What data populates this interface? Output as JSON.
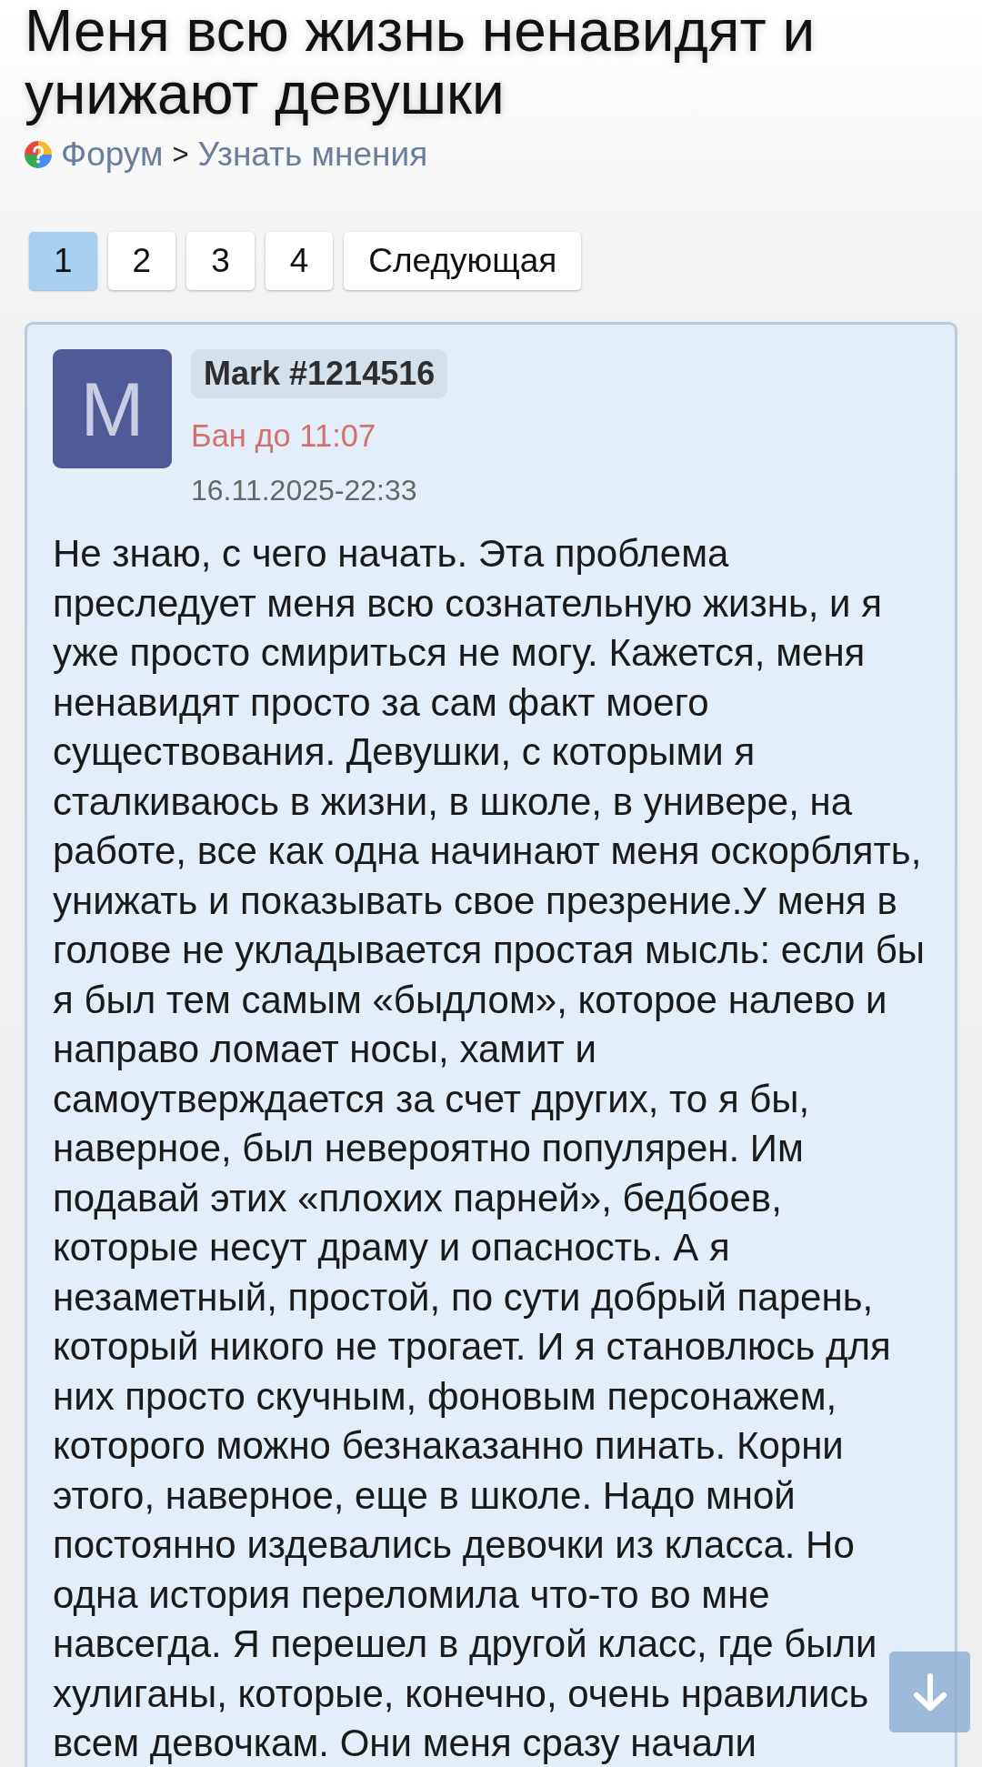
{
  "title": "Меня всю жизнь ненавидят и унижают девушки",
  "breadcrumb": {
    "items": [
      {
        "label": "Форум"
      },
      {
        "label": "Узнать мнения"
      }
    ],
    "separator": ">"
  },
  "pagination": [
    {
      "label": "1",
      "selected": true
    },
    {
      "label": "2",
      "selected": false
    },
    {
      "label": "3",
      "selected": false
    },
    {
      "label": "4",
      "selected": false
    },
    {
      "label": "Следующая",
      "selected": false
    }
  ],
  "post": {
    "avatar_letter": "M",
    "username": "Mark #1214516",
    "ban_status": "Бан до 11:07",
    "date": "16.11.2025-22:33",
    "body": "Не знаю, с чего начать. Эта проблема преследует меня всю сознательную жизнь, и я уже просто смириться не могу. Кажется, меня ненавидят просто за сам факт моего существования. Девушки, с которыми я сталкиваюсь в жизни, в школе, в универе, на работе, все как одна начинают меня оскорблять, унижать и показывать свое презрение.У меня в голове не укладывается простая мысль: если бы я был тем самым «быдлом», которое налево и направо ломает носы, хамит и самоутверждается за счет других, то я бы, наверное, был невероятно популярен. Им подавай этих «плохих парней», бедбоев, которые несут драму и опасность. А я незаметный, простой, по сути добрый парень, который никого не трогает. И я становлюсь для них просто скучным, фоновым персонажем, которого можно безнаказанно пинать. Корни этого, наверное, еще в школе. Надо мной постоянно издевались девочки из класса. Но одна история переломила что-то во мне навсегда. Я перешел в другой класс, где были хулиганы, которые, конечно, очень нравились всем девочкам. Они меня сразу начали"
  }
}
